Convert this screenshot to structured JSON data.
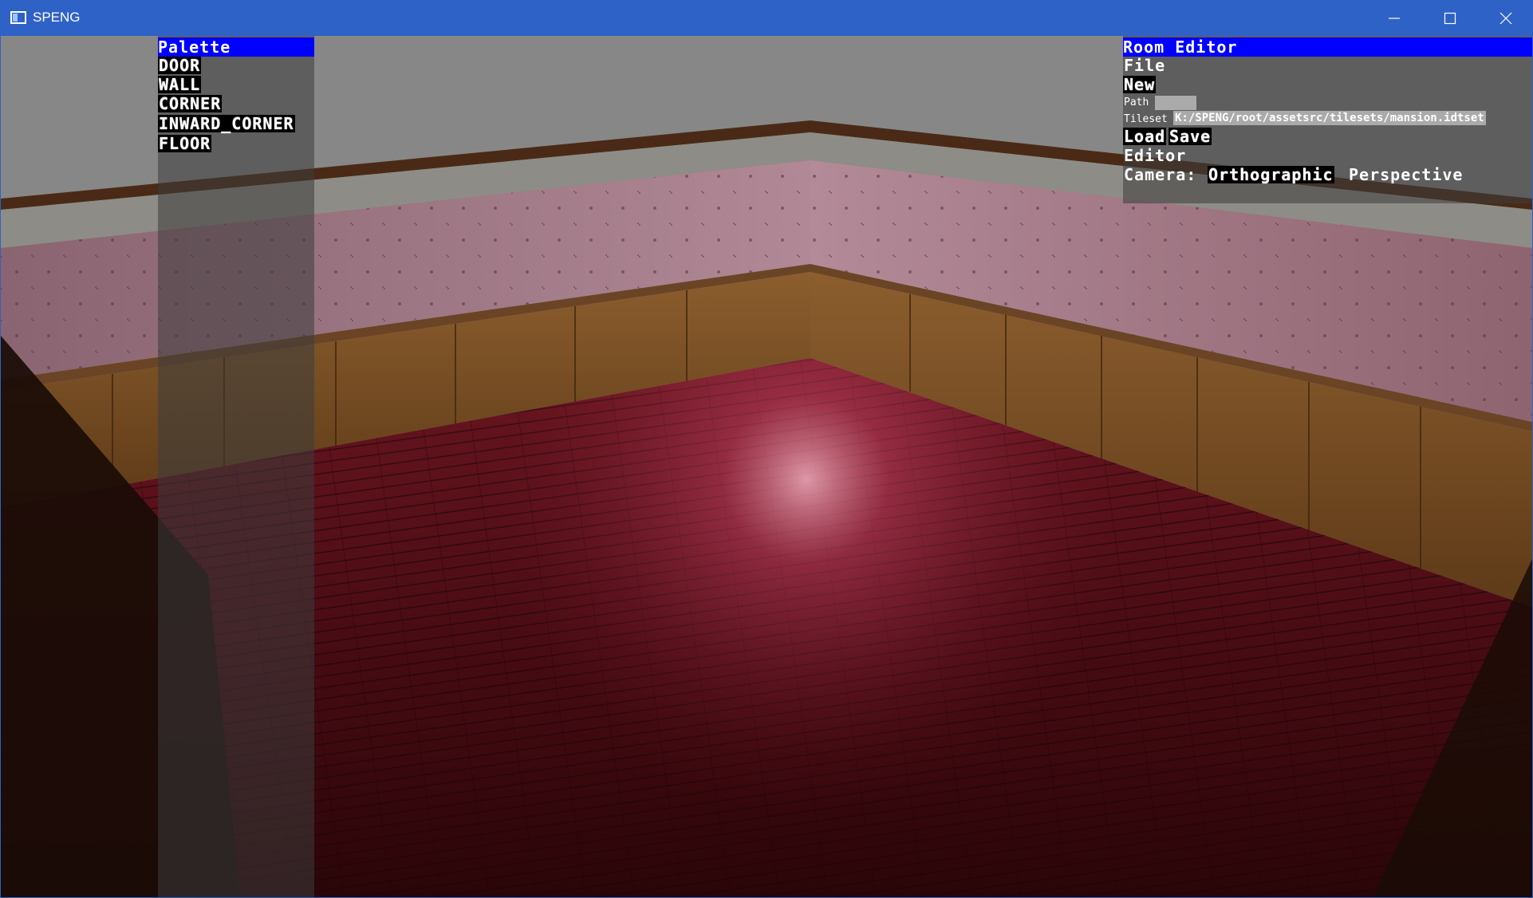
{
  "window": {
    "title": "SPENG",
    "controls": {
      "minimize": "minimize",
      "maximize": "maximize",
      "close": "close"
    }
  },
  "palette": {
    "header": "Palette",
    "items": [
      "DOOR",
      "WALL",
      "CORNER",
      "INWARD_CORNER",
      "FLOOR"
    ]
  },
  "room_editor": {
    "header": "Room Editor",
    "file_label": "File",
    "new_button": "New",
    "path_label": "Path",
    "path_value": "",
    "tileset_label": "Tileset",
    "tileset_value": "K:/SPENG/root/assetsrc/tilesets/mansion.idtset",
    "load_button": "Load",
    "save_button": "Save",
    "editor_label": "Editor",
    "camera_label": "Camera:",
    "camera_orthographic": "Orthographic",
    "camera_perspective": "Perspective"
  },
  "colors": {
    "titlebar": "#2f62c6",
    "header": "#0000ff",
    "sky": "#878787",
    "floor": "#4a0b12",
    "wallpaper": "#9a6f78",
    "wainscot": "#8a5a2b"
  }
}
